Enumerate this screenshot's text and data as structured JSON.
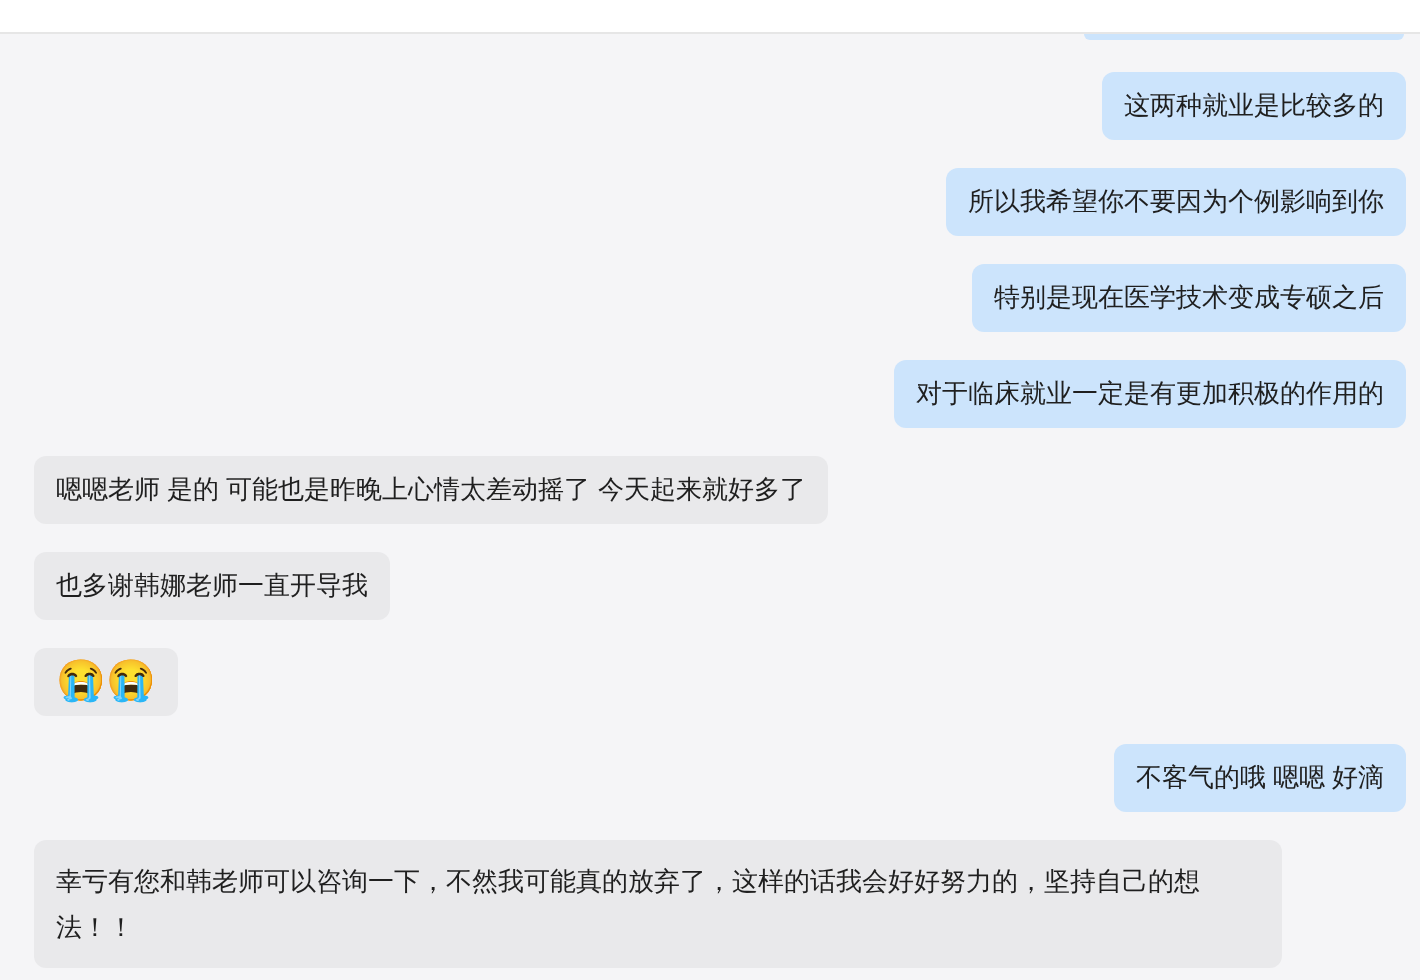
{
  "partial_bubble": {
    "outgoing": true
  },
  "messages": [
    {
      "outgoing": true,
      "text": "这两种就业是比较多的"
    },
    {
      "outgoing": true,
      "text": "所以我希望你不要因为个例影响到你"
    },
    {
      "outgoing": true,
      "text": "特别是现在医学技术变成专硕之后"
    },
    {
      "outgoing": true,
      "text": "对于临床就业一定是有更加积极的作用的"
    },
    {
      "outgoing": false,
      "text": "嗯嗯老师 是的 可能也是昨晚上心情太差动摇了 今天起来就好多了"
    },
    {
      "outgoing": false,
      "text": "也多谢韩娜老师一直开导我"
    },
    {
      "outgoing": false,
      "text": "😭😭",
      "kind": "emoji"
    },
    {
      "outgoing": true,
      "text": "不客气的哦 嗯嗯  好滴"
    },
    {
      "outgoing": false,
      "text": "幸亏有您和韩老师可以咨询一下，不然我可能真的放弃了，这样的话我会好好努力的，坚持自己的想法！！"
    }
  ]
}
